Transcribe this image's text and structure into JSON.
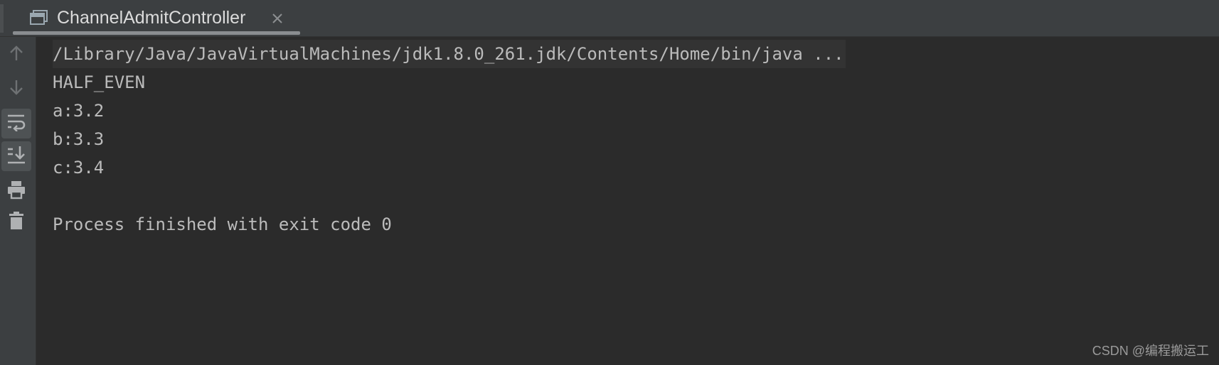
{
  "tab": {
    "title": "ChannelAdmitController",
    "icon": "run-console-icon",
    "close_icon": "close-icon"
  },
  "toolbar": {
    "buttons": [
      {
        "icon": "arrow-up-icon",
        "label": "Up to previous occurrence",
        "active": false
      },
      {
        "icon": "arrow-down-icon",
        "label": "Down to next occurrence",
        "active": false
      },
      {
        "icon": "soft-wrap-icon",
        "label": "Soft-wrap",
        "active": true
      },
      {
        "icon": "scroll-to-end-icon",
        "label": "Scroll to the end",
        "active": true
      },
      {
        "icon": "print-icon",
        "label": "Print",
        "active": false
      },
      {
        "icon": "trash-icon",
        "label": "Clear All",
        "active": false
      }
    ]
  },
  "console": {
    "lines": [
      "/Library/Java/JavaVirtualMachines/jdk1.8.0_261.jdk/Contents/Home/bin/java ...",
      "HALF_EVEN",
      "a:3.2",
      "b:3.3",
      "c:3.4",
      "",
      "Process finished with exit code 0"
    ]
  },
  "watermark": "CSDN @编程搬运工",
  "colors": {
    "background": "#2b2b2b",
    "panel": "#3c3f41",
    "text": "#bbbbbb",
    "icon": "#afb1b3"
  }
}
